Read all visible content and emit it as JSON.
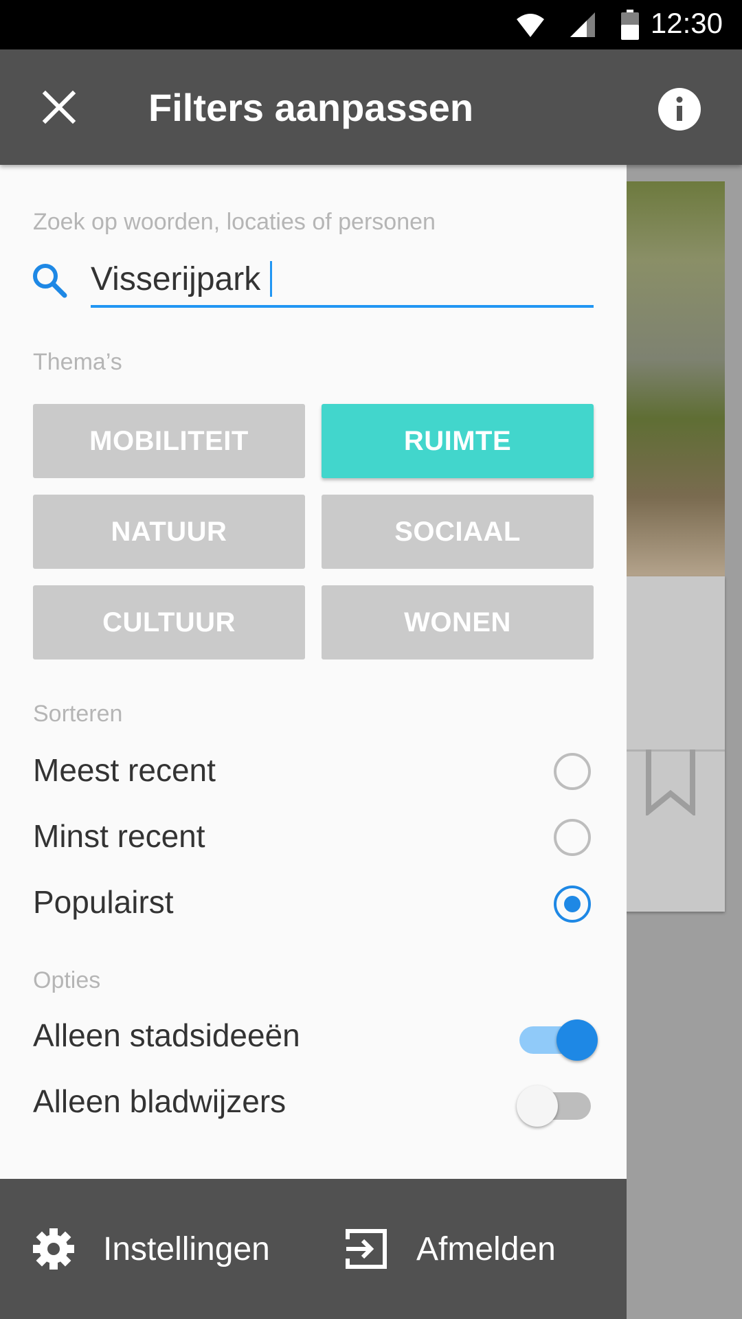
{
  "status_bar": {
    "time": "12:30"
  },
  "app_bar": {
    "title": "Filters aanpassen"
  },
  "search": {
    "label": "Zoek op woorden, locaties of personen",
    "value": "Visserijpark"
  },
  "themes": {
    "label": "Thema’s",
    "items": [
      {
        "label": "MOBILITEIT",
        "active": false
      },
      {
        "label": "RUIMTE",
        "active": true
      },
      {
        "label": "NATUUR",
        "active": false
      },
      {
        "label": "SOCIAAL",
        "active": false
      },
      {
        "label": "CULTUUR",
        "active": false
      },
      {
        "label": "WONEN",
        "active": false
      }
    ]
  },
  "sort": {
    "label": "Sorteren",
    "options": [
      {
        "label": "Meest recent",
        "selected": false
      },
      {
        "label": "Minst recent",
        "selected": false
      },
      {
        "label": "Populairst",
        "selected": true
      }
    ]
  },
  "options": {
    "label": "Opties",
    "items": [
      {
        "label": "Alleen stadsideeën",
        "on": true
      },
      {
        "label": "Alleen bladwijzers",
        "on": false
      }
    ]
  },
  "bottom_bar": {
    "settings_label": "Instellingen",
    "logout_label": "Afmelden"
  },
  "colors": {
    "accent": "#2196f3",
    "active_theme": "#42d6cc",
    "bar": "#515151"
  }
}
